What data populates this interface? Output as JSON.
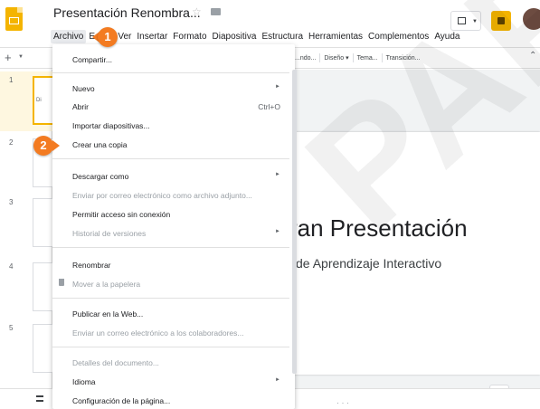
{
  "app": {
    "doc_title": "Presentación Renombra...",
    "menus": [
      "Archivo",
      "Editar",
      "Ver",
      "Insertar",
      "Formato",
      "Diapositiva",
      "Estructura",
      "Herramientas",
      "Complementos",
      "Ayuda"
    ]
  },
  "toolbar": {
    "items": [
      "...ndo...",
      "Diseño ▾",
      "Tema...",
      "Transición..."
    ]
  },
  "filmstrip": {
    "slides": [
      {
        "num": "1",
        "text": "Di"
      },
      {
        "num": "2",
        "text": ""
      },
      {
        "num": "3",
        "text": ""
      },
      {
        "num": "4",
        "text": ""
      },
      {
        "num": "5",
        "text": ""
      }
    ]
  },
  "slide": {
    "title": "ran Presentación",
    "subtitle": "de Aprendizaje Interactivo"
  },
  "file_menu": {
    "items": [
      {
        "label": "Compartir...",
        "enabled": true
      },
      {
        "label": "Nuevo",
        "enabled": true,
        "submenu": true
      },
      {
        "label": "Abrir",
        "enabled": true,
        "shortcut": "Ctrl+O"
      },
      {
        "label": "Importar diapositivas...",
        "enabled": true
      },
      {
        "label": "Crear una copia",
        "enabled": true
      },
      {
        "label": "Descargar como",
        "enabled": true,
        "submenu": true
      },
      {
        "label": "Enviar por correo electrónico como archivo adjunto...",
        "enabled": false
      },
      {
        "label": "Permitir acceso sin conexión",
        "enabled": true
      },
      {
        "label": "Historial de versiones",
        "enabled": false,
        "submenu": true
      },
      {
        "label": "Renombrar",
        "enabled": true
      },
      {
        "label": "Mover a la papelera",
        "enabled": false,
        "icon": "trash-icon"
      },
      {
        "label": "Publicar en la Web...",
        "enabled": true
      },
      {
        "label": "Enviar un correo electrónico a los colaboradores...",
        "enabled": false
      },
      {
        "label": "Detalles del documento...",
        "enabled": false
      },
      {
        "label": "Idioma",
        "enabled": true,
        "submenu": true
      },
      {
        "label": "Configuración de la página...",
        "enabled": true
      }
    ]
  },
  "callouts": [
    "1",
    "2"
  ],
  "watermark": "PAP",
  "colors": {
    "accent": "#f4b400",
    "callout": "#f37b21",
    "disabled_text": "#9aa0a6"
  }
}
